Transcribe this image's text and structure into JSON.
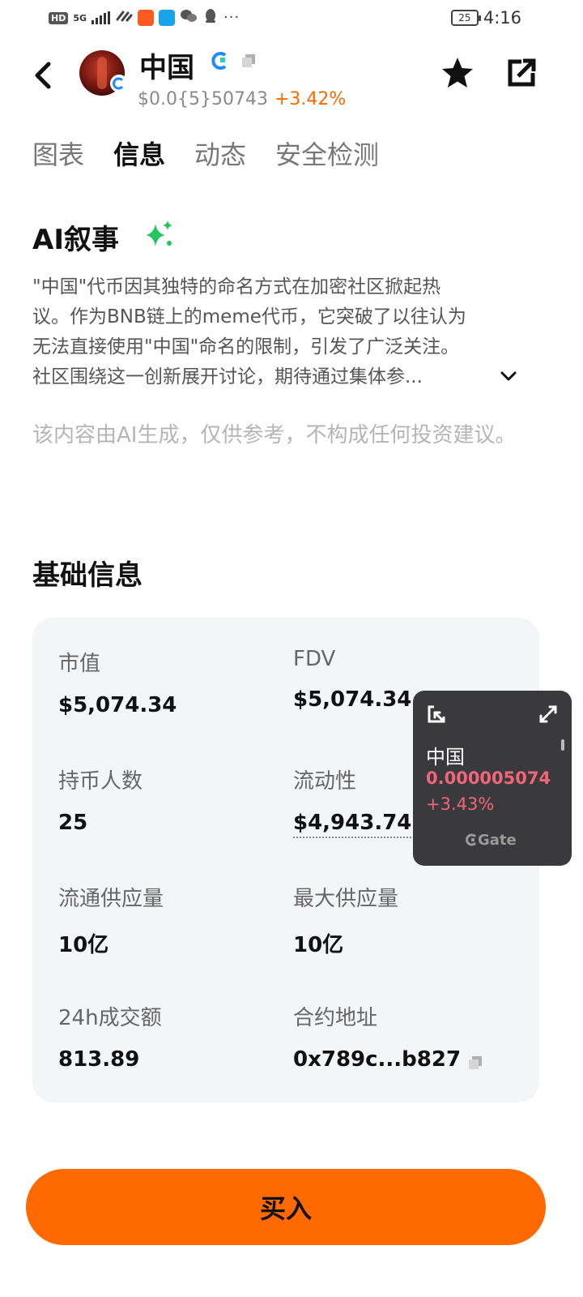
{
  "status_bar": {
    "hd": "HD",
    "net_label": "5G",
    "battery": "25",
    "time": "4:16",
    "more": "···"
  },
  "header": {
    "title": "中国",
    "price": "$0.0{5}50743",
    "change": "+3.42%",
    "change_color": "#ff6a00"
  },
  "tabs": [
    {
      "label": "图表",
      "active": false
    },
    {
      "label": "信息",
      "active": true
    },
    {
      "label": "动态",
      "active": false
    },
    {
      "label": "安全检测",
      "active": false
    }
  ],
  "ai_section": {
    "title": "AI叙事",
    "lines": [
      "\"中国\"代币因其独特的命名方式在加密社区掀起热",
      "议。作为BNB链上的meme代币，它突破了以往认为",
      "无法直接使用\"中国\"命名的限制，引发了广泛关注。",
      "社区围绕这一创新展开讨论，期待通过集体参..."
    ],
    "disclaimer": "该内容由AI生成，仅供参考，不构成任何投资建议。"
  },
  "basic_info": {
    "title": "基础信息",
    "items": [
      {
        "label": "市值",
        "value": "$5,074.34"
      },
      {
        "label": "FDV",
        "value": "$5,074.34"
      },
      {
        "label": "持币人数",
        "value": "25"
      },
      {
        "label": "流动性",
        "value": "$4,943.74"
      },
      {
        "label": "流通供应量",
        "value": "10亿"
      },
      {
        "label": "最大供应量",
        "value": "10亿"
      },
      {
        "label": "24h成交额",
        "value": "813.89"
      },
      {
        "label": "合约地址",
        "value": "0x789c...b827"
      }
    ]
  },
  "widget": {
    "name": "中国",
    "price": "0.000005074",
    "change": "+3.43%",
    "logo": "Gate",
    "price_color": "#f2657a"
  },
  "buy_button": {
    "label": "买入",
    "color": "#ff6a00"
  },
  "icons": [
    "back-arrow-icon",
    "gate-logo-icon",
    "copy-icon",
    "star-icon",
    "share-icon",
    "sparkle-icon",
    "chevron-down-icon",
    "shrink-icon",
    "expand-icon"
  ]
}
